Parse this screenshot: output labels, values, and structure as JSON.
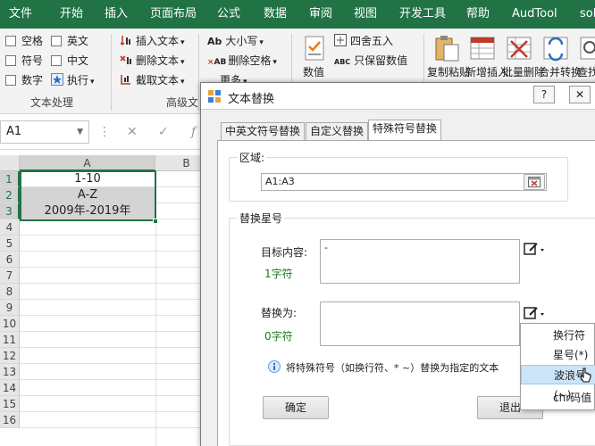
{
  "ribbon_tabs": [
    "文件",
    "开始",
    "插入",
    "页面布局",
    "公式",
    "数据",
    "审阅",
    "视图",
    "开发工具",
    "帮助",
    "AudTool",
    "solu"
  ],
  "ribbon": {
    "checkboxes": [
      "空格",
      "英文",
      "符号",
      "中文",
      "数字"
    ],
    "execute": "执行",
    "group1_label": "文本处理",
    "insert_text": "插入文本",
    "delete_text": "删除文本",
    "cut_text": "截取文本",
    "group2_label": "高级文",
    "case": "大小写",
    "delete_space": "删除空格",
    "more": "更多",
    "value_btn": "数值",
    "round_label": "四舍五入",
    "keep_value": "只保留数值",
    "copy_paste": "复制粘贴",
    "add_insert": "新增插入",
    "batch_delete": "批量删除",
    "merge_convert": "合并转换",
    "find": "查找",
    "ab_icon": "Ab",
    "abc_icon": "ABC"
  },
  "formula_bar": {
    "name_box": "A1"
  },
  "sheet": {
    "columns": [
      "A",
      "B"
    ],
    "rows": [
      "1",
      "2",
      "3",
      "4",
      "5",
      "6",
      "7",
      "8",
      "9",
      "10",
      "11",
      "12",
      "13",
      "14",
      "15",
      "16"
    ],
    "cells": [
      "1-10",
      "A-Z",
      "2009年-2019年"
    ]
  },
  "dialog": {
    "title": "文本替换",
    "tabs": [
      "中英文符号替换",
      "自定义替换",
      "特殊符号替换"
    ],
    "region_label": "区域:",
    "region_value": "A1:A3",
    "replace_group": "替换星号",
    "target_label": "目标内容:",
    "target_count": "1字符",
    "target_value": "-",
    "replace_label": "替换为:",
    "replace_count": "0字符",
    "replace_value": "",
    "info_text": "将特殊符号（如换行符、* ~）替换为指定的文本",
    "ok": "确定",
    "exit": "退出",
    "help_btn": "?"
  },
  "menu": {
    "items": [
      "换行符",
      "星号(*)",
      "波浪号(~)",
      "chr码值"
    ]
  },
  "colors": {
    "ribbon_green": "#217346",
    "selection_green": "#217346",
    "menu_hover": "#cce4f7"
  }
}
